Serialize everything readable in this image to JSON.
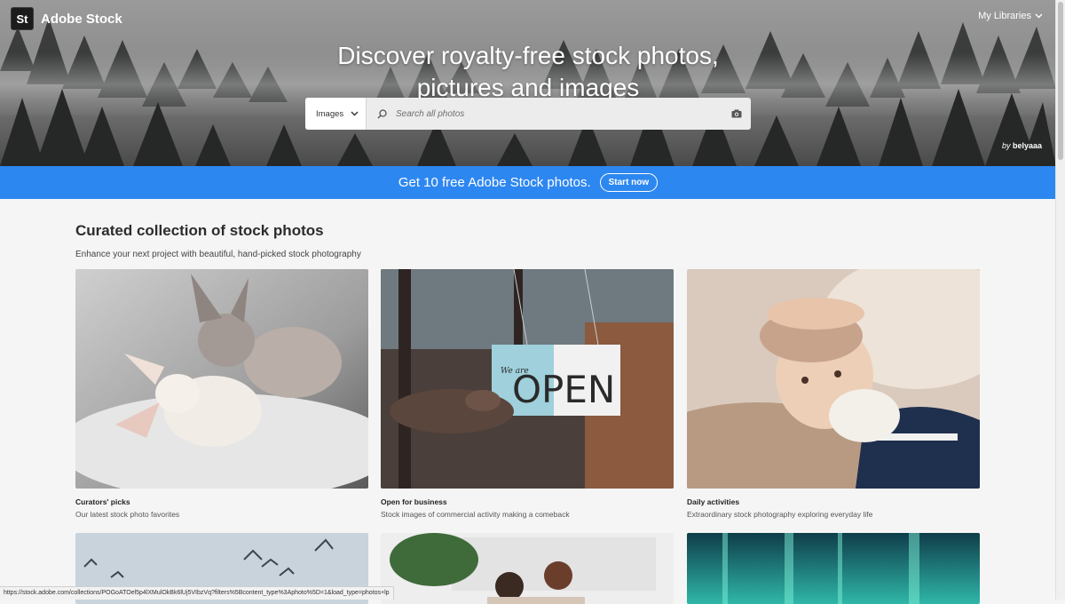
{
  "header": {
    "logo_badge": "St",
    "logo_text": "Adobe Stock",
    "libraries_label": "My Libraries"
  },
  "hero": {
    "title": "Discover royalty-free stock photos, pictures and images",
    "credit_prefix": "by",
    "credit_author": "belyaaa"
  },
  "search": {
    "type_selected": "Images",
    "placeholder": "Search all photos",
    "value": ""
  },
  "promo": {
    "text": "Get 10 free Adobe Stock photos.",
    "button_label": "Start now",
    "color": "#2d87f0"
  },
  "collection": {
    "title": "Curated collection of stock photos",
    "subtitle": "Enhance your next project with beautiful, hand-picked stock photography",
    "cards": [
      {
        "title": "Curators' picks",
        "description": "Our latest stock photo favorites"
      },
      {
        "title": "Open for business",
        "description": "Stock images of commercial activity making a comeback",
        "sign_small": "We are",
        "sign_big": "OPEN"
      },
      {
        "title": "Daily activities",
        "description": "Extraordinary stock photography exploring everyday life"
      }
    ]
  },
  "status_url": "https://stock.adobe.com/collections/POGoATOel5p4lXMulOkBk6lUj5VIbzVq?filters%5Bcontent_type%3Aphoto%5D=1&load_type=photos+lp"
}
